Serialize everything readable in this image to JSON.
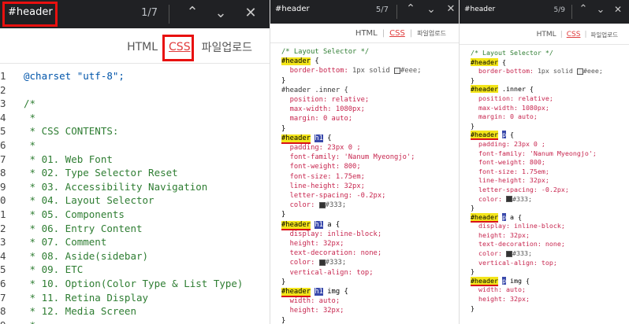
{
  "panel1": {
    "find": {
      "query": "#header",
      "count": "1/7"
    },
    "tabs": {
      "html": "HTML",
      "css": "CSS",
      "upload": "파일업로드"
    },
    "lines": [
      {
        "n": "1",
        "t": "@charset \"utf-8\";"
      },
      {
        "n": "2",
        "t": ""
      },
      {
        "n": "3",
        "t": "/*"
      },
      {
        "n": "4",
        "t": " *"
      },
      {
        "n": "5",
        "t": " * CSS CONTENTS:"
      },
      {
        "n": "6",
        "t": " *"
      },
      {
        "n": "7",
        "t": " * 01. Web Font"
      },
      {
        "n": "8",
        "t": " * 02. Type Selector Reset"
      },
      {
        "n": "9",
        "t": " * 03. Accessibility Navigation"
      },
      {
        "n": "0",
        "t": " * 04. Layout Selector"
      },
      {
        "n": "1",
        "t": " * 05. Components"
      },
      {
        "n": "2",
        "t": " * 06. Entry Content"
      },
      {
        "n": "3",
        "t": " * 07. Comment"
      },
      {
        "n": "4",
        "t": " * 08. Aside(sidebar)"
      },
      {
        "n": "5",
        "t": " * 09. ETC"
      },
      {
        "n": "6",
        "t": " * 10. Option(Color Type & List Type)"
      },
      {
        "n": "7",
        "t": " * 11. Retina Display"
      },
      {
        "n": "8",
        "t": " * 12. Media Screen"
      },
      {
        "n": "9",
        "t": " *"
      }
    ]
  },
  "panel2": {
    "find": {
      "query": "#header",
      "count": "5/7"
    },
    "tabs": {
      "html": "HTML",
      "css": "CSS",
      "upload": "파일업로드"
    },
    "header_token": "#header",
    "code": {
      "comment": "/* Layout Selector */",
      "border_prop": "border-bottom:",
      "border_val": "1px solid",
      "border_color": "#eee;",
      "open": "{",
      "close": "}",
      "inner_sel": "#header .inner {",
      "position": "position: relative;",
      "maxwidth": "max-width: 1080px;",
      "margin": "margin: 0 auto;",
      "h1_tag": "h1",
      "h1_rest": " {",
      "padding": "padding: 23px 0 ;",
      "fontfamily": "font-family: 'Nanum Myeongjo';",
      "fontweight": "font-weight: 800;",
      "fontsize": "font-size: 1.75em;",
      "lineheight": "line-height: 32px;",
      "letterspacing": "letter-spacing: -0.2px;",
      "color_prop": "color:",
      "color_val": "#333;",
      "a_rest": " a {",
      "display": "display: inline-block;",
      "height": "height: 32px;",
      "textdeco": "text-decoration: none;",
      "valign": "vertical-align: top;",
      "img_rest": " img {",
      "width": "width: auto;"
    }
  },
  "panel3": {
    "find": {
      "query": "#header",
      "count": "5/9"
    },
    "tabs": {
      "html": "HTML",
      "css": "CSS",
      "upload": "파일업로드"
    },
    "header_token": "#header",
    "p_tag": "p",
    "code_a_rest": "a {",
    "code_img_rest": "img {"
  },
  "colors": {
    "highlight": "#f3e51a",
    "selected_match": "#3949ab",
    "annotation": "#e8100f",
    "findbar": "#202124"
  },
  "icons": [
    "chevron-up-icon",
    "chevron-down-icon",
    "close-icon"
  ]
}
